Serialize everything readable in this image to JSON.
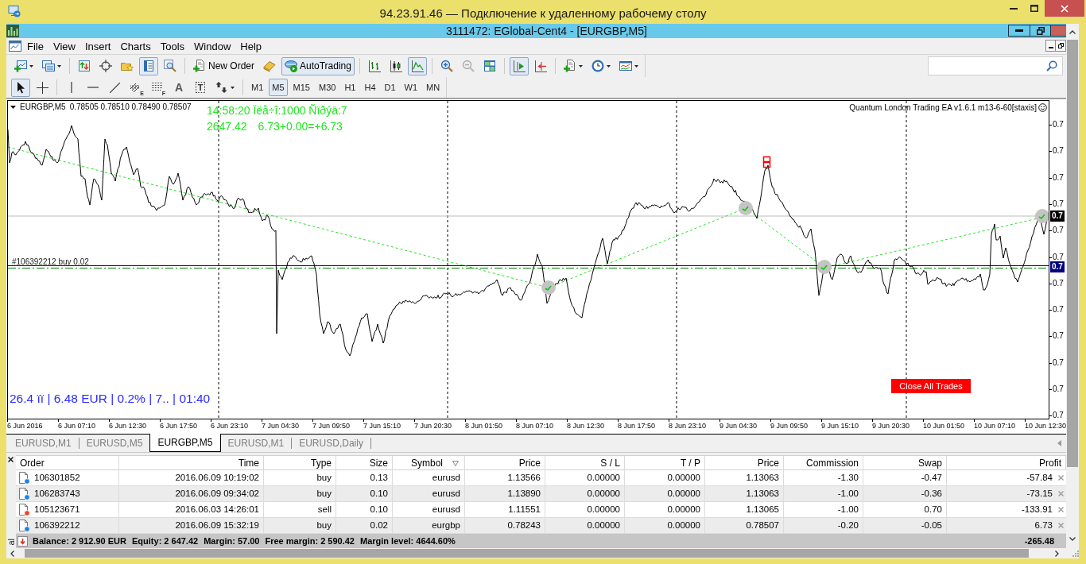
{
  "rdp_window": {
    "title": "94.23.91.46 — Подключение к удаленному рабочему столу"
  },
  "terminal_window": {
    "title": "3111472: EGlobal-Cent4 - [EURGBP,M5]"
  },
  "menu": [
    "File",
    "View",
    "Insert",
    "Charts",
    "Tools",
    "Window",
    "Help"
  ],
  "toolbar": [
    {
      "kind": "new_chart",
      "pressed": false,
      "dropdown": true
    },
    {
      "kind": "profiles",
      "pressed": false,
      "dropdown": true
    },
    {
      "kind": "separator"
    },
    {
      "kind": "market_watch",
      "pressed": false,
      "dropdown": false
    },
    {
      "kind": "navigator",
      "pressed": false,
      "dropdown": false
    },
    {
      "kind": "favorites",
      "pressed": false,
      "dropdown": false
    },
    {
      "kind": "data_window",
      "pressed": true,
      "dropdown": false
    },
    {
      "kind": "tester",
      "pressed": false,
      "dropdown": false
    },
    {
      "kind": "separator"
    },
    {
      "kind": "new_order",
      "label": "New Order",
      "pressed": false,
      "dropdown": false
    },
    {
      "kind": "editor",
      "pressed": false,
      "dropdown": false
    },
    {
      "kind": "autotrading",
      "label": "AutoTrading",
      "pressed": true,
      "dropdown": false
    },
    {
      "kind": "separator"
    },
    {
      "kind": "bar_chart",
      "pressed": false,
      "dropdown": false
    },
    {
      "kind": "candles",
      "pressed": false,
      "dropdown": false
    },
    {
      "kind": "line_chart",
      "pressed": true,
      "dropdown": false
    },
    {
      "kind": "separator"
    },
    {
      "kind": "zoom_in",
      "pressed": false,
      "dropdown": false
    },
    {
      "kind": "zoom_out",
      "pressed": false,
      "dropdown": false
    },
    {
      "kind": "tile",
      "pressed": false,
      "dropdown": false
    },
    {
      "kind": "separator"
    },
    {
      "kind": "chart_shift",
      "pressed": true,
      "dropdown": false
    },
    {
      "kind": "autoscroll",
      "pressed": false,
      "dropdown": false
    },
    {
      "kind": "separator"
    },
    {
      "kind": "indicators",
      "pressed": false,
      "dropdown": true
    },
    {
      "kind": "periods",
      "pressed": false,
      "dropdown": true
    },
    {
      "kind": "templates",
      "pressed": false,
      "dropdown": true
    }
  ],
  "drawing_tools": [
    {
      "kind": "cursor",
      "pressed": true,
      "dropdown": false
    },
    {
      "kind": "crosshair",
      "pressed": false,
      "dropdown": false
    },
    {
      "kind": "separator"
    },
    {
      "kind": "vertical_line",
      "pressed": false,
      "dropdown": false
    },
    {
      "kind": "horizontal_line",
      "pressed": false,
      "dropdown": false
    },
    {
      "kind": "trendline",
      "pressed": false,
      "dropdown": false
    },
    {
      "kind": "channel",
      "badge": "E",
      "pressed": false,
      "dropdown": false
    },
    {
      "kind": "fibonacci",
      "badge": "F",
      "pressed": false,
      "dropdown": false
    },
    {
      "kind": "text",
      "glyph": "A",
      "pressed": false,
      "dropdown": false
    },
    {
      "kind": "text_label",
      "glyph": "T",
      "pressed": false,
      "dropdown": false
    },
    {
      "kind": "arrows",
      "pressed": false,
      "dropdown": true
    },
    {
      "kind": "separator"
    }
  ],
  "timeframes": [
    {
      "label": "M1",
      "selected": false
    },
    {
      "label": "M5",
      "selected": true
    },
    {
      "label": "M15",
      "selected": false
    },
    {
      "label": "M30",
      "selected": false
    },
    {
      "label": "H1",
      "selected": false
    },
    {
      "label": "H4",
      "selected": false
    },
    {
      "label": "D1",
      "selected": false
    },
    {
      "label": "W1",
      "selected": false
    },
    {
      "label": "MN",
      "selected": false
    }
  ],
  "chart": {
    "symbol": "EURGBP,M5",
    "quotes": "0.78505 0.78510 0.78490 0.78507",
    "info_line": "14:58:20 Ïëå÷î:1000 Ñïðýä:7",
    "equity": "2647.42",
    "profit_sum": "6.73+0.00=+6.73",
    "ea_label": "Quantum London Trading EA v1.6.1 m13-6-60[staxis]",
    "order_label": "#106392212 buy 0.02",
    "stats": "26.4 ïï | 6.48 EUR | 0.2% | 7.. | 01:40",
    "close_button": "Close All Trades",
    "price_labels": [
      "0.7",
      "0.7",
      "0.7",
      "0.7",
      "0.7",
      "0.7",
      "0.7",
      "0.7",
      "0.7",
      "0.7",
      "0.7",
      "0.7"
    ],
    "bid_label": "0.7",
    "order_price_label": "0.7",
    "time_labels": [
      "6 Jun 2016",
      "6 Jun 07:10",
      "6 Jun 12:30",
      "6 Jun 17:50",
      "6 Jun 23:10",
      "7 Jun 04:30",
      "7 Jun 09:50",
      "7 Jun 15:10",
      "7 Jun 20:30",
      "8 Jun 01:50",
      "8 Jun 07:10",
      "8 Jun 12:30",
      "8 Jun 17:50",
      "8 Jun 23:10",
      "9 Jun 04:30",
      "9 Jun 09:50",
      "9 Jun 15:10",
      "9 Jun 20:30",
      "10 Jun 01:50",
      "10 Jun 07:10",
      "10 Jun 12:30"
    ]
  },
  "tabs": [
    {
      "label": "EURUSD,M1",
      "selected": false
    },
    {
      "label": "EURUSD,M5",
      "selected": false
    },
    {
      "label": "EURGBP,M5",
      "selected": true
    },
    {
      "label": "EURUSD,M1",
      "selected": false
    },
    {
      "label": "EURUSD,Daily",
      "selected": false
    }
  ],
  "trades": {
    "side_label": "al",
    "columns": [
      {
        "label": "Order",
        "sorted": false
      },
      {
        "label": "Time",
        "sorted": false
      },
      {
        "label": "Type",
        "sorted": false
      },
      {
        "label": "Size",
        "sorted": false
      },
      {
        "label": "Symbol",
        "sorted": true
      },
      {
        "label": "Price",
        "sorted": false
      },
      {
        "label": "S / L",
        "sorted": false
      },
      {
        "label": "T / P",
        "sorted": false
      },
      {
        "label": "Price",
        "sorted": false
      },
      {
        "label": "Commission",
        "sorted": false
      },
      {
        "label": "Swap",
        "sorted": false
      },
      {
        "label": "Profit",
        "sorted": false
      }
    ],
    "rows": [
      {
        "kind": "buy",
        "cells": [
          "106301852",
          "2016.06.09 10:19:02",
          "buy",
          "0.13",
          "eurusd",
          "1.13566",
          "0.00000",
          "0.00000",
          "1.13063",
          "-1.30",
          "-0.47",
          "-57.84"
        ]
      },
      {
        "kind": "buy",
        "cells": [
          "106283743",
          "2016.06.09 09:34:02",
          "buy",
          "0.10",
          "eurusd",
          "1.13890",
          "0.00000",
          "0.00000",
          "1.13063",
          "-1.00",
          "-0.36",
          "-73.15"
        ]
      },
      {
        "kind": "sell",
        "cells": [
          "105123671",
          "2016.06.03 14:26:01",
          "sell",
          "0.10",
          "eurusd",
          "1.11551",
          "0.00000",
          "0.00000",
          "1.13065",
          "-1.00",
          "0.70",
          "-133.91"
        ]
      },
      {
        "kind": "buy",
        "cells": [
          "106392212",
          "2016.06.09 15:32:19",
          "buy",
          "0.02",
          "eurgbp",
          "0.78243",
          "0.00000",
          "0.00000",
          "0.78507",
          "-0.20",
          "-0.05",
          "6.73"
        ]
      }
    ],
    "summary": {
      "items": [
        "Balance: 2 912.90 EUR",
        "Equity: 2 647.42",
        "Margin: 57.00",
        "Free margin: 2 590.42",
        "Margin level: 4644.60%"
      ],
      "total": "-265.48"
    }
  }
}
